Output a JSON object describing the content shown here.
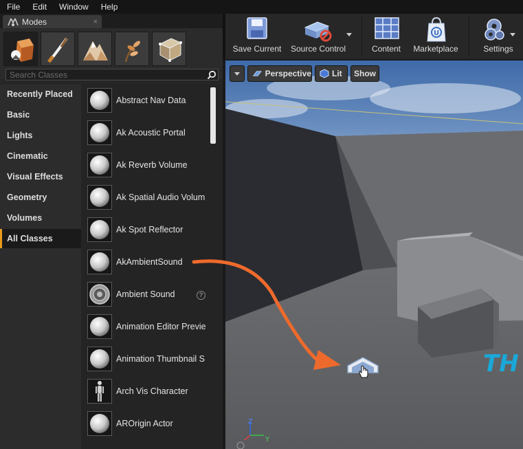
{
  "menu": [
    "File",
    "Edit",
    "Window",
    "Help"
  ],
  "modes_tab": {
    "title": "Modes",
    "close": "×"
  },
  "mode_icons": [
    "place-mode-icon",
    "paint-mode-icon",
    "landscape-mode-icon",
    "foliage-mode-icon",
    "geometry-mode-icon"
  ],
  "search": {
    "placeholder": "Search Classes"
  },
  "categories": [
    "Recently Placed",
    "Basic",
    "Lights",
    "Cinematic",
    "Visual Effects",
    "Geometry",
    "Volumes",
    "All Classes"
  ],
  "active_category": "All Classes",
  "items": [
    {
      "name": "Abstract Nav Data",
      "icon": "sphere"
    },
    {
      "name": "Ak Acoustic Portal",
      "icon": "sphere"
    },
    {
      "name": "Ak Reverb Volume",
      "icon": "sphere"
    },
    {
      "name": "Ak Spatial Audio Volum",
      "icon": "sphere"
    },
    {
      "name": "Ak Spot Reflector",
      "icon": "sphere"
    },
    {
      "name": "AkAmbientSound",
      "icon": "sphere"
    },
    {
      "name": "Ambient Sound",
      "icon": "speaker",
      "help": "?"
    },
    {
      "name": "Animation Editor Previe",
      "icon": "sphere"
    },
    {
      "name": "Animation Thumbnail S",
      "icon": "sphere"
    },
    {
      "name": "Arch Vis Character",
      "icon": "figure"
    },
    {
      "name": "AROrigin Actor",
      "icon": "sphere"
    }
  ],
  "toolbar": [
    {
      "label": "Save Current",
      "icon": "save-icon"
    },
    {
      "label": "Source Control",
      "icon": "source-control-icon"
    },
    {
      "label": "Content",
      "icon": "content-icon"
    },
    {
      "label": "Marketplace",
      "icon": "marketplace-icon"
    },
    {
      "label": "Settings",
      "icon": "settings-icon"
    }
  ],
  "viewport": {
    "perspective": "Perspective",
    "lit": "Lit",
    "show": "Show",
    "axis_z": "Z",
    "axis_y": "Y",
    "overlay_text": "TH"
  },
  "colors": {
    "accent": "#e89a1c",
    "arrow": "#ee6a2c",
    "cyan_text": "#1aa8d8"
  }
}
